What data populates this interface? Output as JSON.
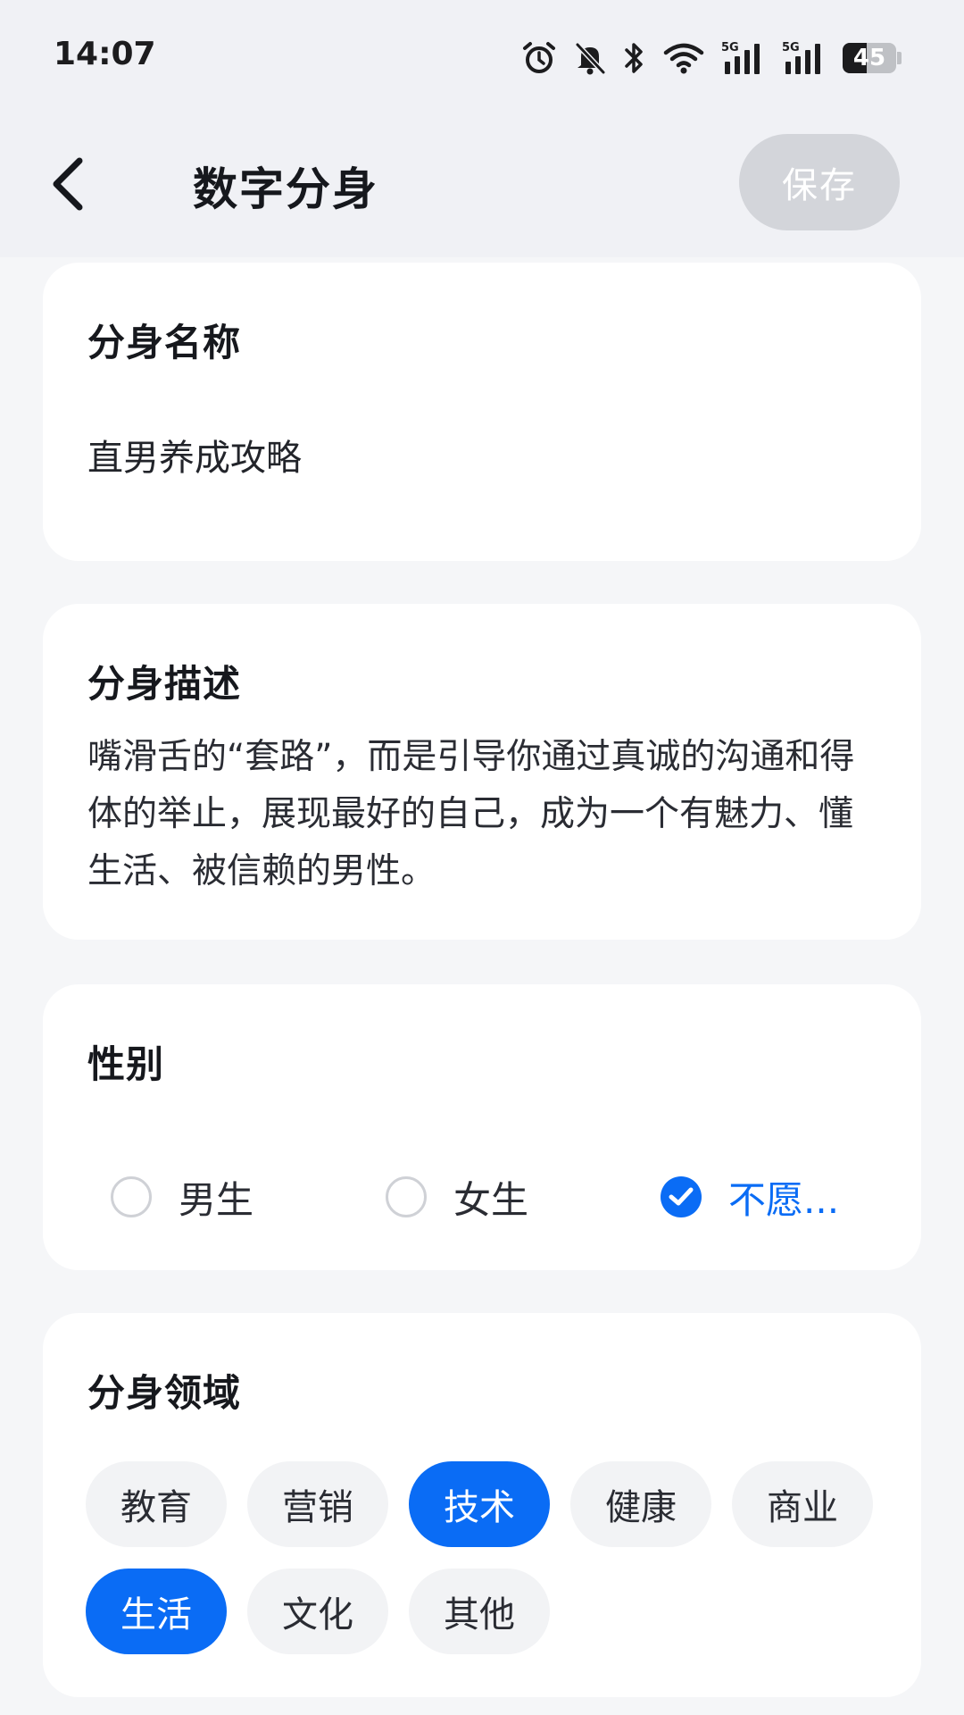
{
  "status_bar": {
    "time": "14:07",
    "battery": "45",
    "battery_level": 0.45,
    "icons": [
      "alarm-icon",
      "bell-off-icon",
      "bluetooth-icon",
      "wifi-icon",
      "signal-5g-icon",
      "signal-5g-icon",
      "battery-icon"
    ]
  },
  "header": {
    "title": "数字分身",
    "save_label": "保存",
    "back_icon": "chevron-left-icon"
  },
  "name_card": {
    "title": "分身名称",
    "value": "直男养成攻略"
  },
  "desc_card": {
    "title": "分身描述",
    "text": "嘴滑舌的“套路”，而是引导你通过真诚的沟通和得体的举止，展现最好的自己，成为一个有魅力、懂生活、被信赖的男性。"
  },
  "gender_card": {
    "title": "性别",
    "options": [
      {
        "label": "男生",
        "checked": false
      },
      {
        "label": "女生",
        "checked": false
      },
      {
        "label": "不愿...",
        "checked": true
      }
    ]
  },
  "domain_card": {
    "title": "分身领域",
    "tags": [
      {
        "label": "教育",
        "selected": false
      },
      {
        "label": "营销",
        "selected": false
      },
      {
        "label": "技术",
        "selected": true
      },
      {
        "label": "健康",
        "selected": false
      },
      {
        "label": "商业",
        "selected": false
      },
      {
        "label": "生活",
        "selected": true
      },
      {
        "label": "文化",
        "selected": false
      },
      {
        "label": "其他",
        "selected": false
      }
    ]
  },
  "colors": {
    "accent": "#0a6cf5",
    "background": "#f5f6f8",
    "header_bg": "#f0f1f5",
    "save_disabled": "#d3d5da",
    "tag_bg": "#f2f3f5"
  }
}
